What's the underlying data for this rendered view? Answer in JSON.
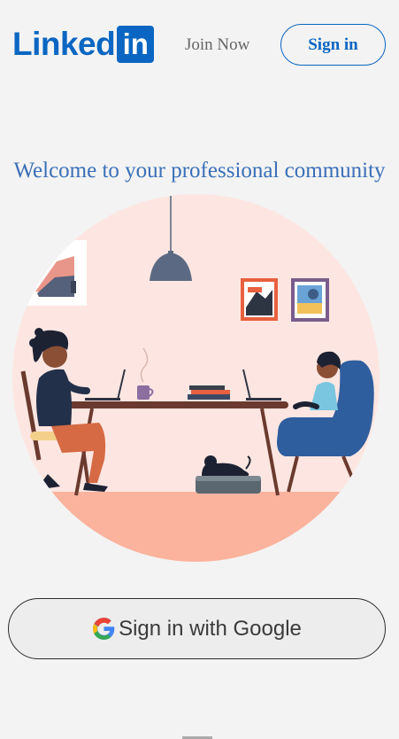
{
  "header": {
    "logo_word": "Linked",
    "logo_box": "in",
    "join_now": "Join Now",
    "sign_in": "Sign in"
  },
  "hero": {
    "title": "Welcome to your professional community"
  },
  "google": {
    "label": "Sign in with Google",
    "icon": "google-g-icon"
  },
  "colors": {
    "brand": "#0a66c2",
    "title": "#3a6fb8",
    "background": "#f3f3f3",
    "circle": "#fde6e1",
    "floor": "#fbb39e"
  }
}
